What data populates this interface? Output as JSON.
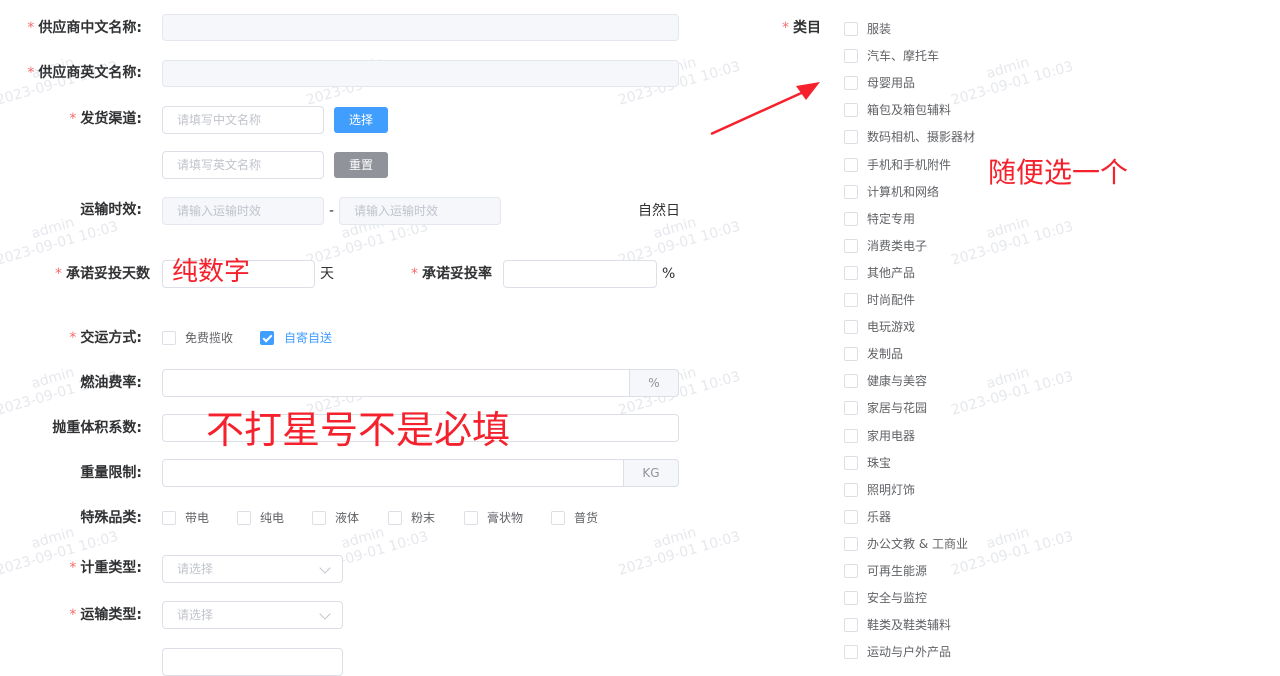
{
  "form": {
    "supplier_cn": {
      "label": "供应商中文名称:"
    },
    "supplier_en": {
      "label": "供应商英文名称:"
    },
    "channel": {
      "label": "发货渠道:",
      "cn_placeholder": "请填写中文名称",
      "en_placeholder": "请填写英文名称",
      "select_btn": "选择",
      "reset_btn": "重置"
    },
    "transit": {
      "label": "运输时效:",
      "from_placeholder": "请输入运输时效",
      "to_placeholder": "请输入运输时效",
      "separator": "-",
      "unit": "自然日"
    },
    "promise_days": {
      "label": "承诺妥投天数",
      "unit": "天"
    },
    "promise_rate": {
      "label": "承诺妥投率",
      "unit": "%"
    },
    "delivery": {
      "label": "交运方式:",
      "options": [
        {
          "label": "免费揽收",
          "checked": false
        },
        {
          "label": "自寄自送",
          "checked": true
        }
      ]
    },
    "fuel": {
      "label": "燃油费率:",
      "unit": "%"
    },
    "volume": {
      "label": "抛重体积系数:"
    },
    "weight_limit": {
      "label": "重量限制:",
      "unit": "KG"
    },
    "special": {
      "label": "特殊品类:",
      "options": [
        "带电",
        "纯电",
        "液体",
        "粉末",
        "膏状物",
        "普货"
      ]
    },
    "billing_type": {
      "label": "计重类型:",
      "placeholder": "请选择"
    },
    "transport_type": {
      "label": "运输类型:",
      "placeholder": "请选择"
    }
  },
  "category": {
    "label": "类目",
    "items": [
      "服装",
      "汽车、摩托车",
      "母婴用品",
      "箱包及箱包辅料",
      "数码相机、摄影器材",
      "手机和手机附件",
      "计算机和网络",
      "特定专用",
      "消费类电子",
      "其他产品",
      "时尚配件",
      "电玩游戏",
      "发制品",
      "健康与美容",
      "家居与花园",
      "家用电器",
      "珠宝",
      "照明灯饰",
      "乐器",
      "办公文教 & 工商业",
      "可再生能源",
      "安全与监控",
      "鞋类及鞋类辅料",
      "运动与户外产品"
    ]
  },
  "annotations": {
    "pure_number": "纯数字",
    "not_required": "不打星号不是必填",
    "pick_one": "随便选一个"
  },
  "watermark": {
    "user": "admin",
    "time": "2023-09-01 10:03"
  },
  "colors": {
    "primary": "#409eff",
    "required": "#f56c6c",
    "annotation": "#f5222d"
  }
}
